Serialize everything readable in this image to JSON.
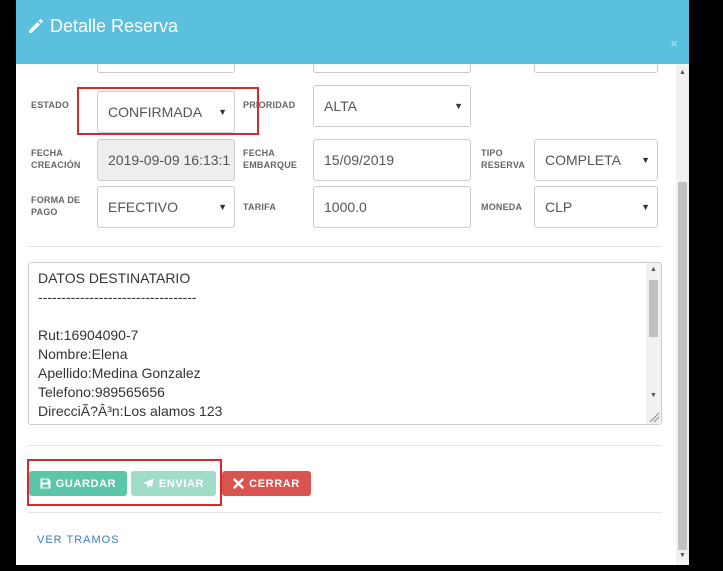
{
  "modal": {
    "title": "Detalle Reserva",
    "close_glyph": "×",
    "header_color": "#5bc0de",
    "pencil_icon": "pencil-icon"
  },
  "form": {
    "estado": {
      "label": "ESTADO",
      "value": "CONFIRMADA"
    },
    "prioridad": {
      "label": "PRIORIDAD",
      "value": "ALTA"
    },
    "fecha_creacion": {
      "label_1": "FECHA",
      "label_2": "CREACIÓN",
      "value": "2019-09-09 16:13:1"
    },
    "fecha_embarque": {
      "label_1": "FECHA",
      "label_2": "EMBARQUE",
      "value": "15/09/2019"
    },
    "tipo_reserva": {
      "label_1": "TIPO",
      "label_2": "RESERVA",
      "value": "COMPLETA"
    },
    "forma_pago": {
      "label_1": "FORMA DE",
      "label_2": "PAGO",
      "value": "EFECTIVO"
    },
    "tarifa": {
      "label": "TARIFA",
      "value": "1000.0"
    },
    "moneda": {
      "label": "MONEDA",
      "value": "CLP"
    }
  },
  "notes": {
    "lines": [
      "DATOS DESTINATARIO",
      "----------------------------------",
      "",
      "Rut:16904090-7",
      "Nombre:Elena",
      "Apellido:Medina Gonzalez",
      "Telefono:989565656",
      "DirecciÃ?Â³n:Los alamos 123"
    ]
  },
  "buttons": {
    "guardar": {
      "label": "GUARDAR",
      "color": "#5cc7a8",
      "icon": "save-icon"
    },
    "enviar": {
      "label": "ENVIAR",
      "color": "#9fdcca",
      "icon": "send-icon"
    },
    "cerrar": {
      "label": "CERRAR",
      "color": "#d9534f",
      "icon": "x-icon"
    }
  },
  "links": {
    "ver_tramos": "VER TRAMOS"
  }
}
